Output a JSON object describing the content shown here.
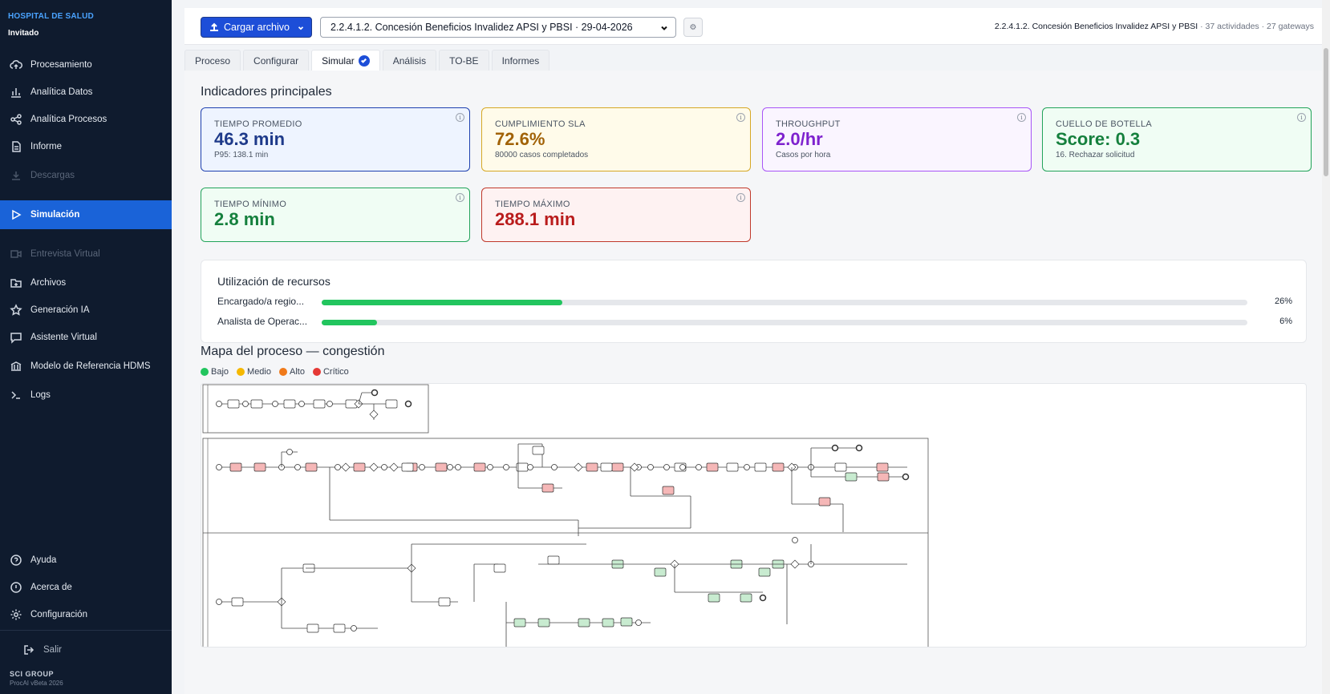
{
  "sidebar": {
    "brand": "HOSPITAL DE SALUD",
    "user": "Invitado",
    "items": [
      {
        "label": "Procesamiento",
        "icon": "cloud-upload-icon",
        "state": "normal"
      },
      {
        "label": "Analítica Datos",
        "icon": "bar-chart-icon",
        "state": "normal"
      },
      {
        "label": "Analítica Procesos",
        "icon": "share-nodes-icon",
        "state": "normal"
      },
      {
        "label": "Informe",
        "icon": "document-icon",
        "state": "normal"
      },
      {
        "label": "Descargas",
        "icon": "download-icon",
        "state": "disabled"
      },
      {
        "label": "Simulación",
        "icon": "play-icon",
        "state": "active"
      },
      {
        "label": "Entrevista Virtual",
        "icon": "video-icon",
        "state": "disabled"
      },
      {
        "label": "Archivos",
        "icon": "folder-plus-icon",
        "state": "normal"
      },
      {
        "label": "Generación IA",
        "icon": "star-icon",
        "state": "normal"
      },
      {
        "label": "Asistente Virtual",
        "icon": "chat-icon",
        "state": "normal"
      },
      {
        "label": "Modelo de Referencia HDMS",
        "icon": "bank-icon",
        "state": "normal"
      },
      {
        "label": "Logs",
        "icon": "terminal-icon",
        "state": "normal"
      }
    ],
    "bottom_items": [
      {
        "label": "Ayuda",
        "icon": "help-circle-icon"
      },
      {
        "label": "Acerca de",
        "icon": "info-circle-icon"
      },
      {
        "label": "Configuración",
        "icon": "gear-icon"
      }
    ],
    "logout_label": "Salir",
    "footer_brand": "SCI GROUP",
    "footer_version": "ProcAI vBeta 2026"
  },
  "header": {
    "upload_label": "Cargar archivo",
    "process_selected": "2.2.4.1.2. Concesión Beneficios Invalidez APSI y PBSI · 29-04-2026",
    "settings_glyph": "⚙",
    "info_title": "2.2.4.1.2. Concesión Beneficios Invalidez APSI y PBSI",
    "info_activities": "37 actividades",
    "info_gateways": "27 gateways",
    "separator": "·"
  },
  "tabs": [
    {
      "label": "Proceso",
      "active": false
    },
    {
      "label": "Configurar",
      "active": false
    },
    {
      "label": "Simular",
      "active": true
    },
    {
      "label": "Análisis",
      "active": false
    },
    {
      "label": "TO-BE",
      "active": false
    },
    {
      "label": "Informes",
      "active": false
    }
  ],
  "kpis_title": "Indicadores principales",
  "kpis": [
    {
      "label": "TIEMPO PROMEDIO",
      "value": "46.3 min",
      "sub": "P95: 138.1 min",
      "color": "blue"
    },
    {
      "label": "CUMPLIMIENTO SLA",
      "value": "72.6%",
      "sub": "80000 casos completados",
      "color": "yellow"
    },
    {
      "label": "THROUGHPUT",
      "value": "2.0/hr",
      "sub": "Casos por hora",
      "color": "purple"
    },
    {
      "label": "CUELLO DE BOTELLA",
      "value": "Score: 0.3",
      "sub": "16. Rechazar solicitud",
      "color": "green"
    },
    {
      "label": "TIEMPO MÍNIMO",
      "value": "2.8 min",
      "sub": "",
      "color": "green"
    },
    {
      "label": "TIEMPO MÁXIMO",
      "value": "288.1 min",
      "sub": "",
      "color": "red"
    }
  ],
  "info_glyph": "i",
  "resources": {
    "title": "Utilización de recursos",
    "rows": [
      {
        "name": "Encargado/a regio...",
        "pct": 26,
        "pct_label": "26%"
      },
      {
        "name": "Analista de Operac...",
        "pct": 6,
        "pct_label": "6%"
      }
    ]
  },
  "map": {
    "title": "Mapa del proceso — congestión",
    "legend": [
      {
        "label": "Bajo",
        "color": "#22c55e"
      },
      {
        "label": "Medio",
        "color": "#f5b800"
      },
      {
        "label": "Alto",
        "color": "#f07a1a"
      },
      {
        "label": "Crítico",
        "color": "#e53935"
      }
    ],
    "colors": {
      "low": "#c8ebd0",
      "high": "#f5b7b7",
      "task": "#ffffff"
    }
  }
}
